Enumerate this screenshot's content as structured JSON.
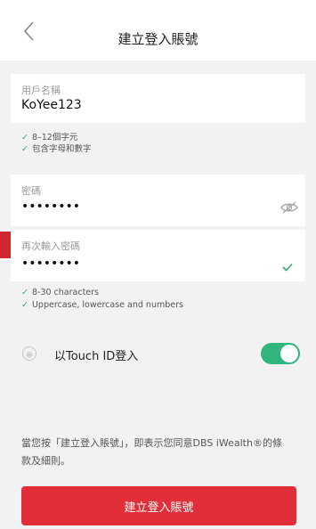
{
  "header": {
    "title": "建立登入賬號"
  },
  "username": {
    "label": "用戶名稱",
    "value": "KoYee123",
    "rules": [
      "8–12個字元",
      "包含字母和數字"
    ]
  },
  "password": {
    "label": "密碼",
    "value": "••••••••"
  },
  "confirm_password": {
    "label": "再次輸入密碼",
    "value": "••••••••",
    "rules": [
      "8-30 characters",
      "Uppercase, lowercase and numbers"
    ]
  },
  "touch_id": {
    "label": "以Touch ID登入",
    "enabled": true
  },
  "terms": {
    "text": "當您按「建立登入賬號」，即表示您同意DBS iWealth®的條款及細則。"
  },
  "submit": {
    "label": "建立登入賬號"
  },
  "colors": {
    "accent": "#e22e38",
    "toggle_on": "#30b57c",
    "check": "#30a868"
  },
  "icons": [
    "back-chevron-icon",
    "eye-off-icon",
    "check-icon",
    "fingerprint-icon"
  ]
}
